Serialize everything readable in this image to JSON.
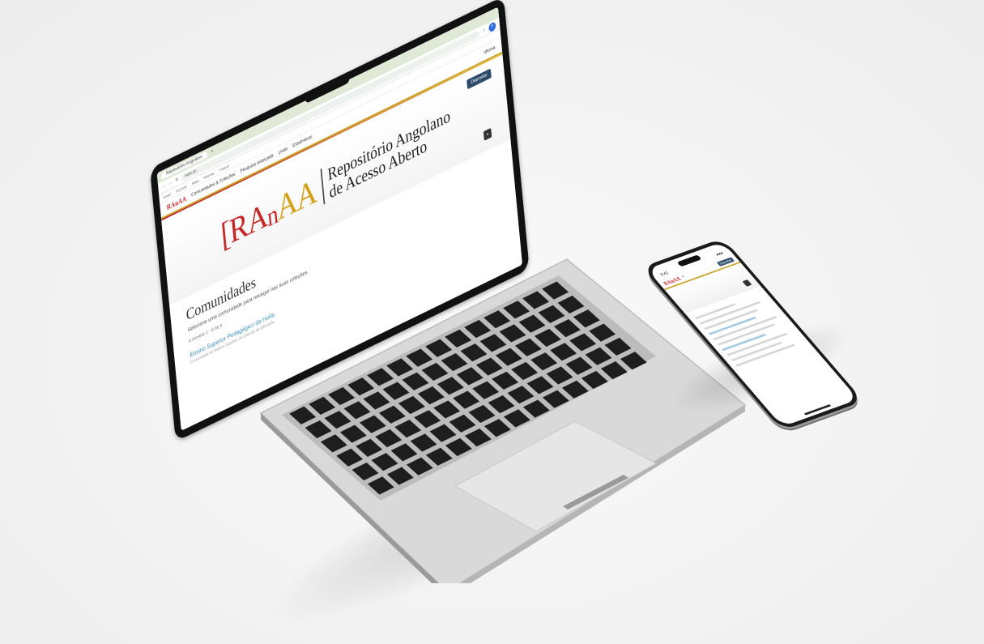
{
  "browser": {
    "tab_title": "Repositório Angolano",
    "url": "raaa.ao",
    "avatar_letter": "Y",
    "bookmarks": [
      "Gmail",
      "YouTube",
      "Maps",
      "Notícias",
      "Traduzir"
    ]
  },
  "site": {
    "mini_logo": "RAnAA",
    "nav": [
      "Comunidades & Coleções",
      "Pesquisa avançada",
      "Listar",
      "Estatísticas"
    ],
    "lang": "Idioma",
    "deposit_label": "Depositar",
    "logo": {
      "r": "[RA",
      "an": "n",
      "aa": "AA"
    },
    "title_line1": "Repositório Angolano",
    "title_line2": "de Acesso Aberto",
    "section_heading": "Comunidades",
    "section_sub": "Selecione uma comunidade para navegar nas suas coleções.",
    "section_small": "A mostrar 1 - 8 de 8",
    "first_link": "Ensino Superior Pedagógico da Huíla",
    "first_desc": "Comunidade do Instituto Superior de Ciências da Educação"
  },
  "phone": {
    "time": "9:41",
    "signal": "●●●"
  },
  "colors": {
    "brand_red": "#c62828",
    "brand_gold": "#d4a017",
    "deposit_blue": "#2d4a6b",
    "link_blue": "#3c8dbc"
  }
}
